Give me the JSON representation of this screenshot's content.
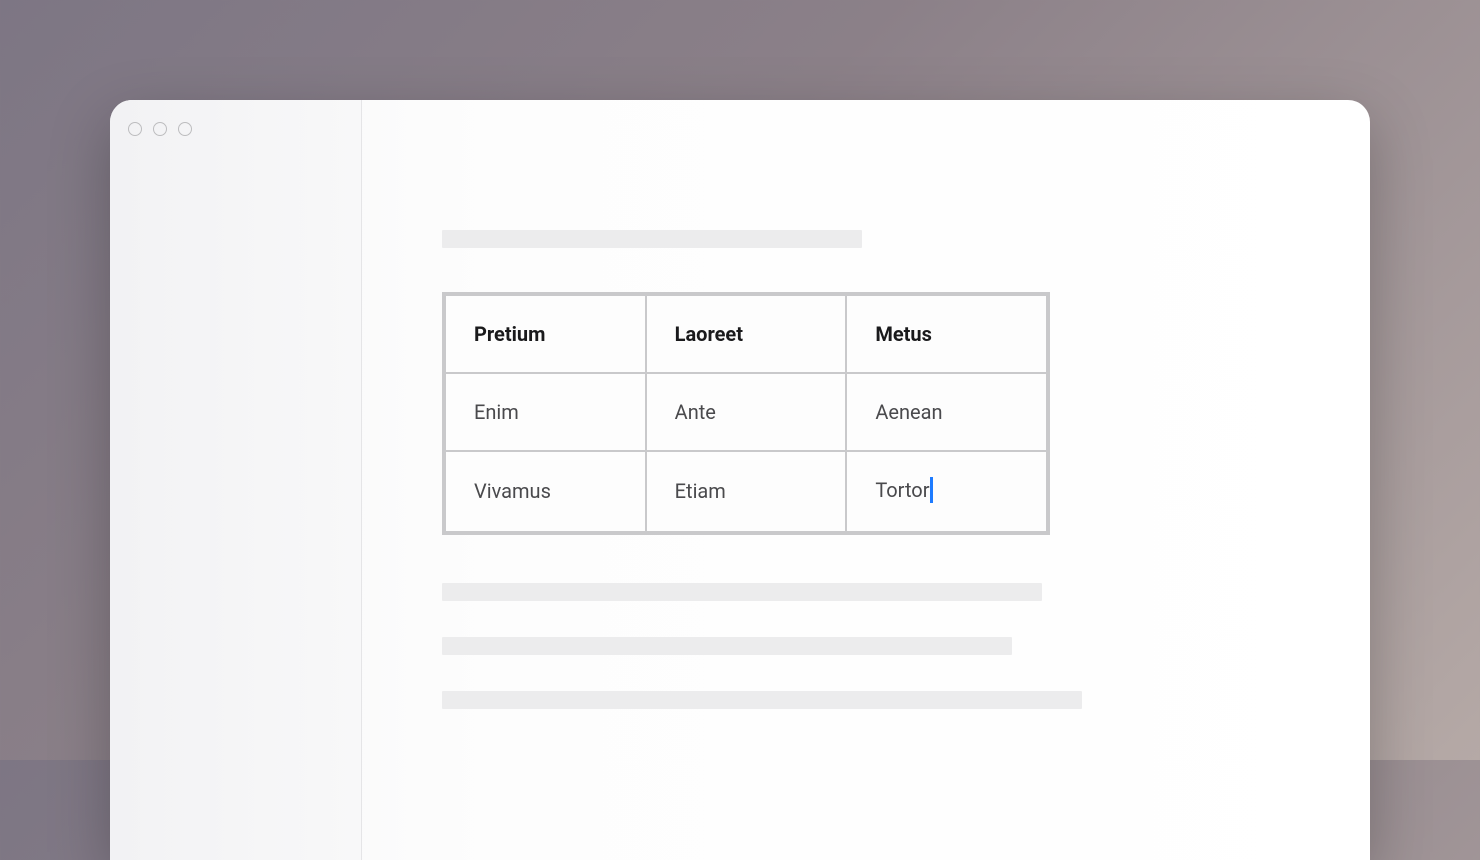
{
  "table": {
    "headers": [
      "Pretium",
      "Laoreet",
      "Metus"
    ],
    "rows": [
      [
        "Enim",
        "Ante",
        "Aenean"
      ],
      [
        "Vivamus",
        "Etiam",
        "Tortor"
      ]
    ],
    "cursor": {
      "row": 1,
      "col": 2
    }
  }
}
